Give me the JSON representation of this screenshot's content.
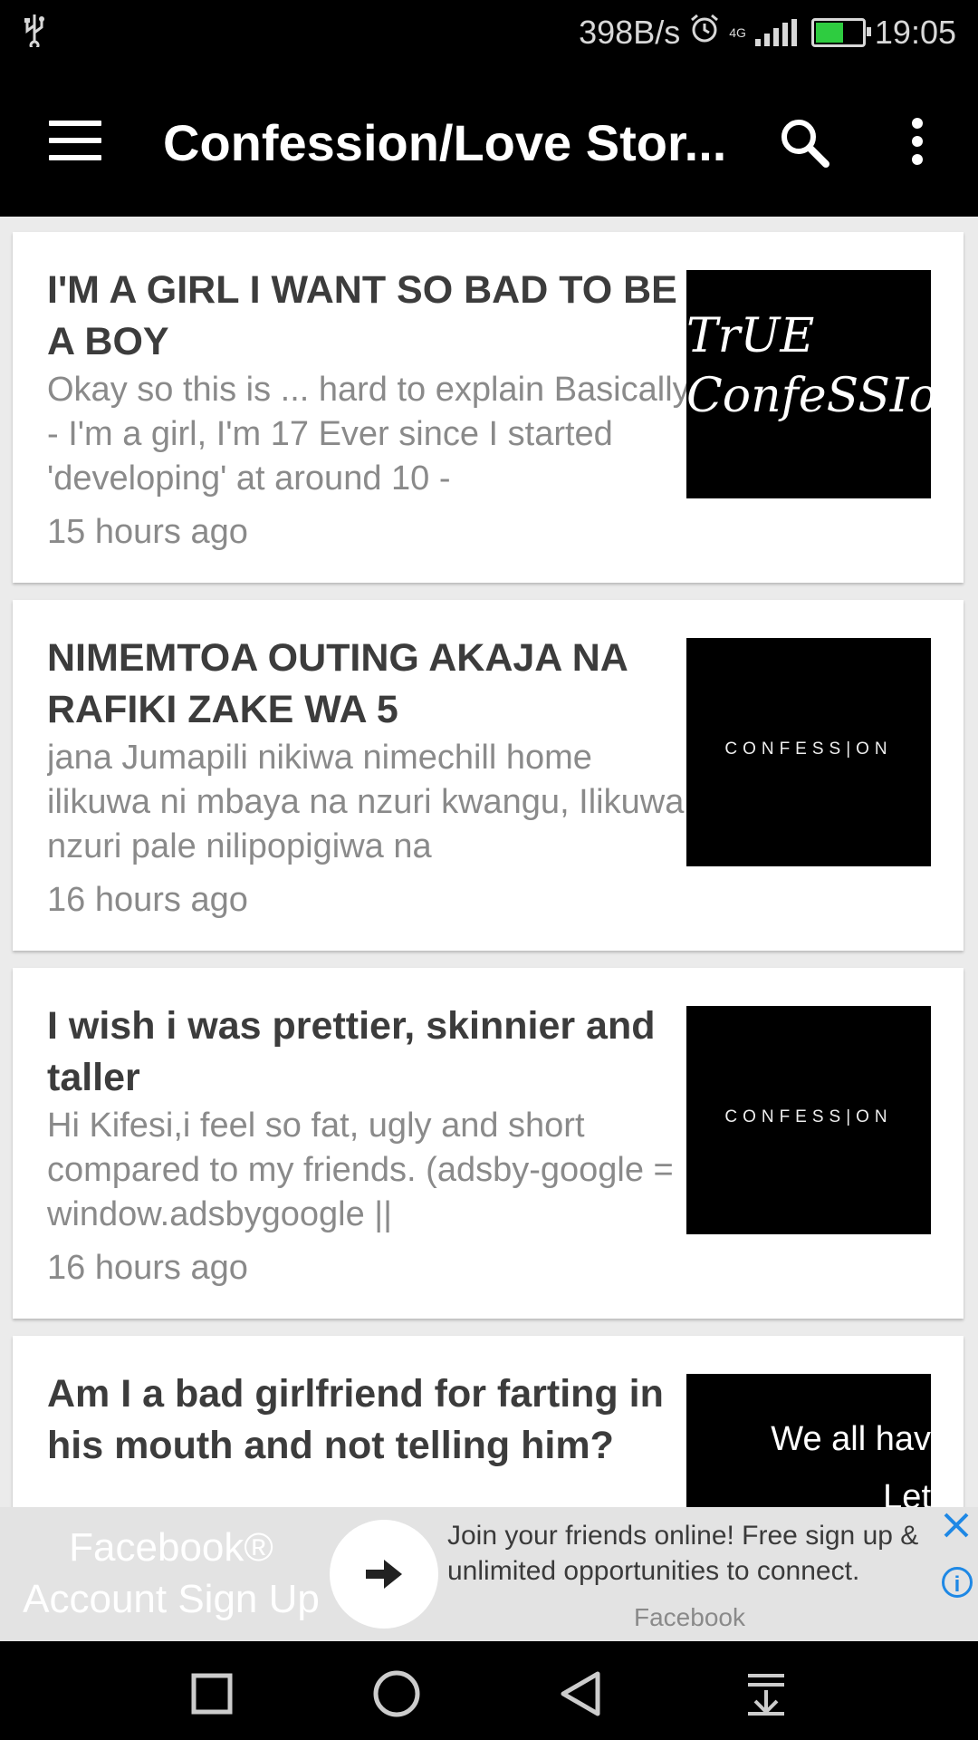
{
  "status_bar": {
    "network_speed": "398B/s",
    "network_type": "4G",
    "time": "19:05",
    "icons": [
      "usb-icon",
      "alarm-icon",
      "signal-icon",
      "battery-charging-icon"
    ]
  },
  "toolbar": {
    "title": "Confession/Love Stor...",
    "icons": [
      "menu-icon",
      "search-icon",
      "more-vert-icon"
    ]
  },
  "posts": [
    {
      "title": "I'M A GIRL I WANT SO BAD TO BE A BOY",
      "excerpt": "Okay so this is ... hard to explain Basically - I'm a girl, I'm 17 Ever since I started 'developing' at around 10 -",
      "time": "15 hours ago",
      "thumb_text": "TrUE ConfeSSIons"
    },
    {
      "title": "NIMEMTOA OUTING AKAJA NA RAFIKI ZAKE WA 5",
      "excerpt": "jana Jumapili nikiwa nimechill home ilikuwa ni mbaya na nzuri kwangu, Ilikuwa nzuri pale nilipopigiwa na",
      "time": "16 hours ago",
      "thumb_text": "CONFESS|ON"
    },
    {
      "title": "I wish i was prettier, skinnier and taller",
      "excerpt": "Hi Kifesi,i feel so fat, ugly and short compared to my friends. (adsby-google = window.adsbygoogle ||",
      "time": "16 hours ago",
      "thumb_text": "CONFESS|ON"
    },
    {
      "title": "Am I a bad girlfriend for farting in his mouth and not telling him?",
      "excerpt": "",
      "time": "",
      "thumb_text_line1": "We all hav",
      "thumb_text_line2": "Let"
    }
  ],
  "ad": {
    "headline": "Facebook® Account Sign Up",
    "body": "Join your friends online! Free sign up & unlimited opportunities to connect.",
    "advertiser": "Facebook",
    "icons": [
      "arrow-right-icon",
      "close-icon",
      "info-icon"
    ],
    "accent_color": "#1e88e5"
  },
  "nav_bar": {
    "icons": [
      "recents-icon",
      "home-icon",
      "back-icon",
      "notification-drawer-icon"
    ]
  }
}
